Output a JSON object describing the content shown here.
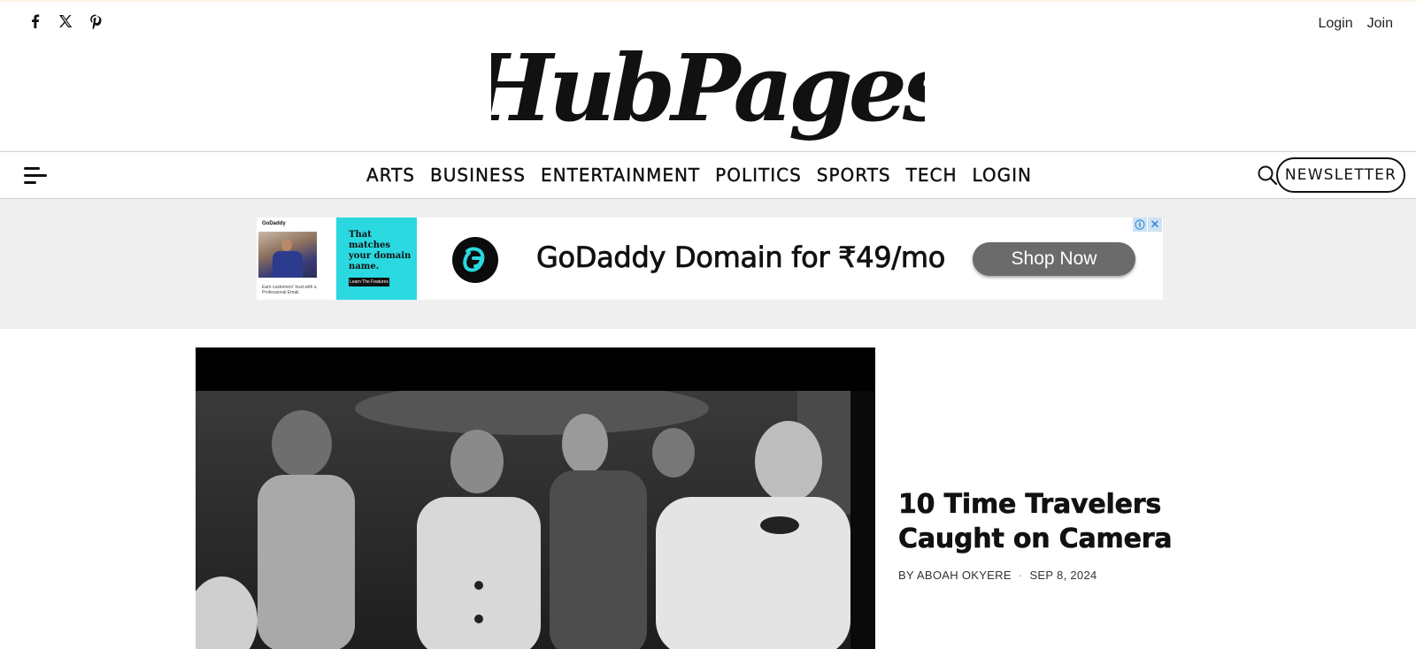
{
  "header": {
    "social": [
      {
        "name": "facebook-icon"
      },
      {
        "name": "x-icon"
      },
      {
        "name": "pinterest-icon"
      }
    ],
    "login_label": "Login",
    "join_label": "Join",
    "logo_text": "HubPages"
  },
  "nav": {
    "menu_icon": "hamburger-menu-icon",
    "items": [
      "ARTS",
      "BUSINESS",
      "ENTERTAINMENT",
      "POLITICS",
      "SPORTS",
      "TECH",
      "LOGIN"
    ],
    "search_icon": "search-icon",
    "newsletter_label": "NEWSLETTER"
  },
  "ad": {
    "brand_mini": "GoDaddy",
    "fine_print": "Earn customers' trust with a Professional Email.",
    "teal_text": "That matches your domain name.",
    "teal_button": "Learn The Features",
    "headline": "GoDaddy Domain for ₹49/mo",
    "cta": "Shop Now",
    "info_icon": "ⓘ",
    "close_icon": "✕",
    "teal_color": "#2ad8e0"
  },
  "featured": {
    "title": "10 Time Travelers Caught on Camera",
    "byline": "BY ABOAH OKYERE",
    "date": "SEP 8, 2024"
  }
}
